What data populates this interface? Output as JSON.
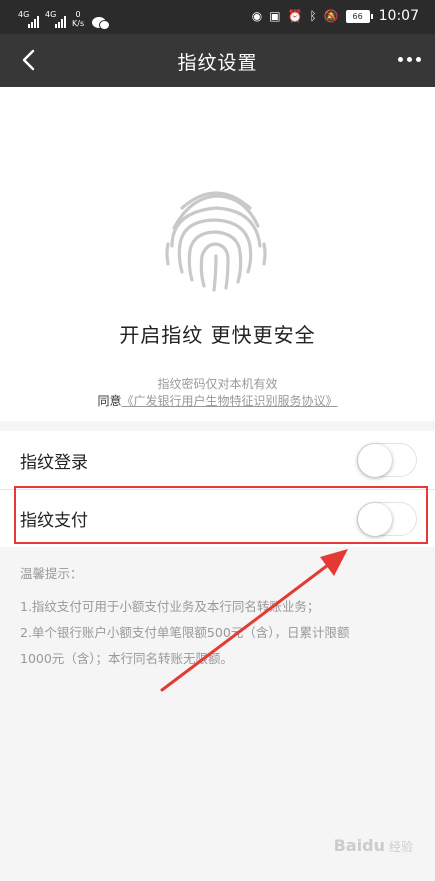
{
  "status_bar": {
    "sim1": "4G",
    "sim2": "4G",
    "speed_value": "0",
    "speed_unit": "K/s",
    "battery": "66",
    "time": "10:07"
  },
  "nav": {
    "title": "指纹设置"
  },
  "hero": {
    "headline": "开启指纹 更快更安全",
    "note": "指纹密码仅对本机有效",
    "agree_prefix": "同意",
    "agreement_link": "《广发银行用户生物特征识别服务协议》"
  },
  "settings": [
    {
      "label": "指纹登录",
      "enabled": false
    },
    {
      "label": "指纹支付",
      "enabled": false
    }
  ],
  "tips": {
    "title": "温馨提示：",
    "line1": "1.指纹支付可用于小额支付业务及本行同名转账业务；",
    "line2": "2.单个银行账户小额支付单笔限额500元（含），日累计限额",
    "line3": "1000元（含）；本行同名转账无限额。"
  },
  "watermark": {
    "brand": "Baidu",
    "suffix": "经验"
  },
  "colors": {
    "status_bar_bg": "#2b2b2b",
    "nav_bg": "#373737",
    "highlight": "#e53935",
    "arrow": "#e53935"
  }
}
